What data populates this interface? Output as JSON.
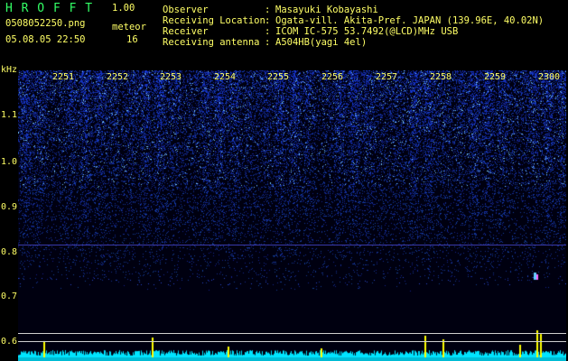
{
  "app": {
    "title": "H R O F F T",
    "version": "1.00"
  },
  "file": {
    "name": "0508052250.png",
    "datetime": "05.08.05 22:50"
  },
  "meteor": {
    "label": "meteor",
    "count": "16"
  },
  "info": [
    {
      "label": "Observer",
      "sep": ":",
      "value": "Masayuki Kobayashi"
    },
    {
      "label": "Receiving Location",
      "sep": ":",
      "value": "Ogata-vill. Akita-Pref. JAPAN (139.96E, 40.02N)"
    },
    {
      "label": "Receiver",
      "sep": ":",
      "value": "ICOM IC-575 53.7492(@LCD)MHz USB"
    },
    {
      "label": "Receiving antenna",
      "sep": ":",
      "value": "A504HB(yagi 4el)"
    }
  ],
  "axis": {
    "unit": "kHz",
    "freq_ticks": [
      "1.1",
      "1.0",
      "0.9",
      "0.8",
      "0.7",
      "0.6"
    ],
    "time_ticks": [
      "2251",
      "2252",
      "2253",
      "2254",
      "2255",
      "2256",
      "2257",
      "2258",
      "2259",
      "2300"
    ]
  },
  "colors": {
    "background": "#000000",
    "text_yellow": "#ffff66",
    "title_green": "#33ff66",
    "noise_blue": "#2a3cff",
    "noise_cyan": "#66ccff",
    "baseline_cyan": "#00e5ff",
    "spike_yellow": "#ffff00"
  }
}
